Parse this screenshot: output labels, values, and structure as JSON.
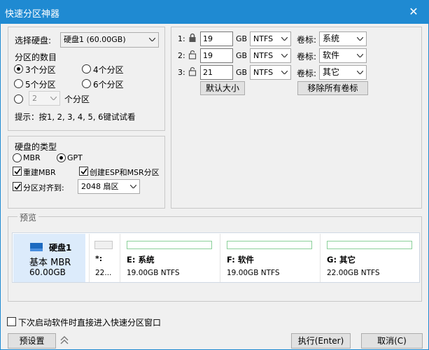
{
  "window": {
    "title": "快速分区神器",
    "close": "✕"
  },
  "disk_select": {
    "label": "选择硬盘:",
    "value": "硬盘1 (60.00GB)"
  },
  "partition_count": {
    "heading": "分区的数目",
    "options": [
      "3个分区",
      "4个分区",
      "5个分区",
      "6个分区"
    ],
    "custom_value": "2",
    "custom_suffix": "个分区",
    "hint": "提示：按1, 2, 3, 4, 5, 6键试试看"
  },
  "disk_type": {
    "heading": "硬盘的类型",
    "mbr": "MBR",
    "gpt": "GPT",
    "rebuild_mbr": "重建MBR",
    "create_esp_msr": "创建ESP和MSR分区",
    "align": "分区对齐到:",
    "align_value": "2048 扇区"
  },
  "partitions": {
    "rows": [
      {
        "index": "1:",
        "size": "19",
        "unit": "GB",
        "fs": "NTFS",
        "label_caption": "卷标:",
        "label": "系统"
      },
      {
        "index": "2:",
        "size": "19",
        "unit": "GB",
        "fs": "NTFS",
        "label_caption": "卷标:",
        "label": "软件"
      },
      {
        "index": "3:",
        "size": "21",
        "unit": "GB",
        "fs": "NTFS",
        "label_caption": "卷标:",
        "label": "其它"
      }
    ],
    "default_size_button": "默认大小",
    "remove_labels_button": "移除所有卷标"
  },
  "preview": {
    "heading": "预览",
    "disk": {
      "name": "硬盘1",
      "type": "基本 MBR",
      "size": "60.00GB"
    },
    "cards": [
      {
        "title": "*:",
        "detail": "22..."
      },
      {
        "title": "E: 系统",
        "detail": "19.00GB NTFS"
      },
      {
        "title": "F: 软件",
        "detail": "19.00GB NTFS"
      },
      {
        "title": "G: 其它",
        "detail": "22.00GB NTFS"
      }
    ]
  },
  "footer": {
    "startup_checkbox": "下次启动软件时直接进入快速分区窗口",
    "preset_button": "预设置",
    "execute_button": "执行(Enter)",
    "cancel_button": "取消(C)"
  }
}
